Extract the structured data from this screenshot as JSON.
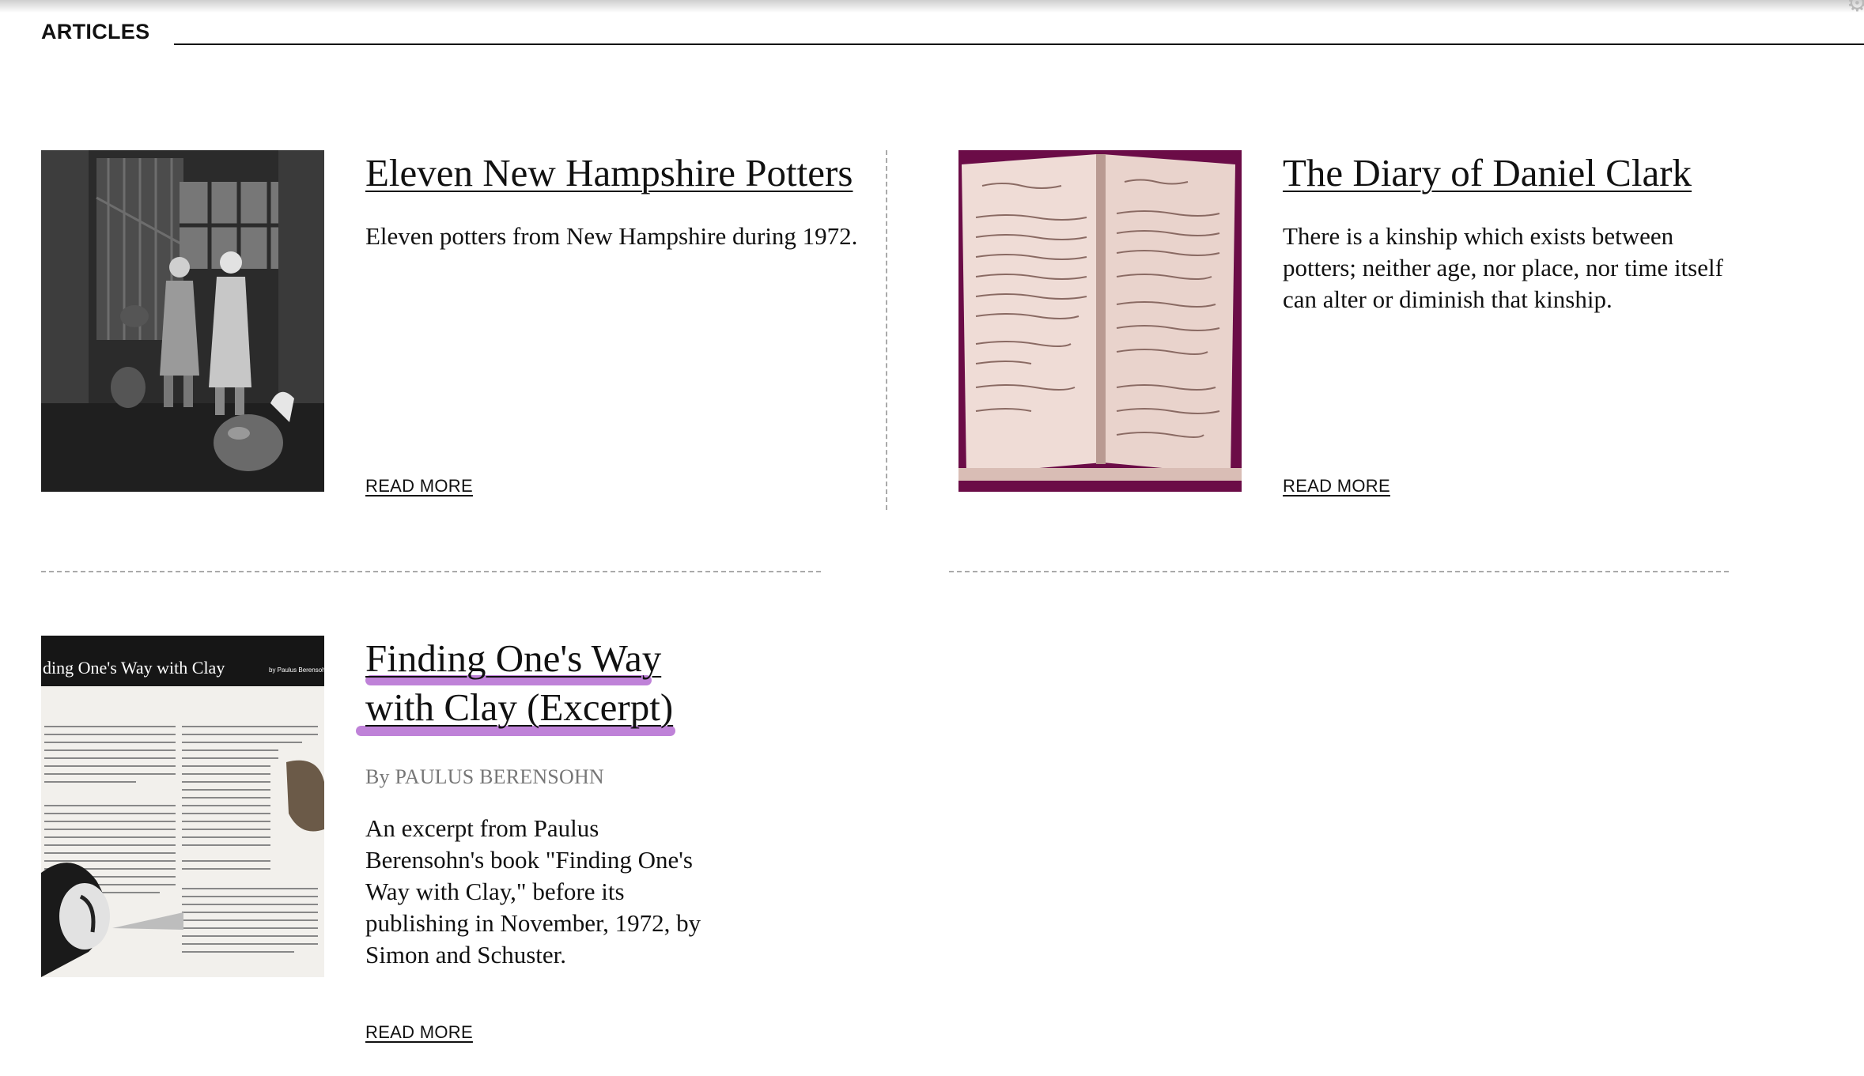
{
  "section": {
    "heading": "ARTICLES"
  },
  "articles": [
    {
      "title": "Eleven New Hampshire Potters",
      "summary": "Eleven potters from New Hampshire during 1972.",
      "read_more": "READ MORE",
      "thumbnail_icon": "potters-photo"
    },
    {
      "title": "The Diary of Daniel Clark",
      "summary": "There is a kinship which exists between potters; neither age, nor place, nor time itself can alter or diminish that kinship.",
      "read_more": "READ MORE",
      "thumbnail_icon": "diary-photo"
    },
    {
      "title_line1": "Finding One's Way",
      "title_line2": "with Clay (Excerpt)",
      "byline": "By PAULUS BERENSOHN",
      "summary": "An excerpt from Paulus Berensohn's book \"Finding One's Way with Clay,\" before its publishing in November, 1972, by Simon and Schuster.",
      "read_more": "READ MORE",
      "thumbnail_icon": "book-page-photo",
      "thumbnail_caption": "ding One's Way with Clay",
      "thumbnail_byline": "by Paulus Berensohn"
    }
  ],
  "colors": {
    "highlight": "#b46cd1",
    "diary_backdrop": "#6b0c47",
    "divider": "#aaaaaa"
  }
}
